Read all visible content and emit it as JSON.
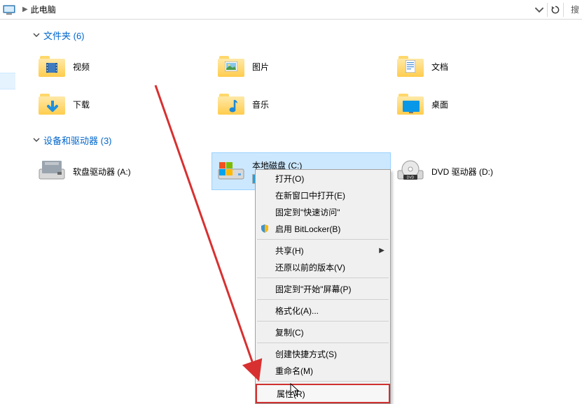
{
  "address": {
    "title": "此电脑",
    "search": "搜"
  },
  "sections": {
    "folders": {
      "header": "文件夹 (6)"
    },
    "devices": {
      "header": "设备和驱动器 (3)"
    }
  },
  "folders": [
    {
      "label": "视频"
    },
    {
      "label": "图片"
    },
    {
      "label": "文档"
    },
    {
      "label": "下载"
    },
    {
      "label": "音乐"
    },
    {
      "label": "桌面"
    }
  ],
  "drives": {
    "floppy": {
      "label": "软盘驱动器 (A:)"
    },
    "localc": {
      "label": "本地磁盘 (C:)",
      "used_pct": 22
    },
    "dvd": {
      "label": "DVD 驱动器 (D:)"
    }
  },
  "ctx": {
    "open": "打开(O)",
    "new_window": "在新窗口中打开(E)",
    "pin_quick": "固定到\"快速访问\"",
    "bitlocker": "启用 BitLocker(B)",
    "share": "共享(H)",
    "prev_ver": "还原以前的版本(V)",
    "pin_start": "固定到\"开始\"屏幕(P)",
    "format": "格式化(A)...",
    "copy": "复制(C)",
    "shortcut": "创建快捷方式(S)",
    "rename": "重命名(M)",
    "properties": "属性(R)"
  }
}
